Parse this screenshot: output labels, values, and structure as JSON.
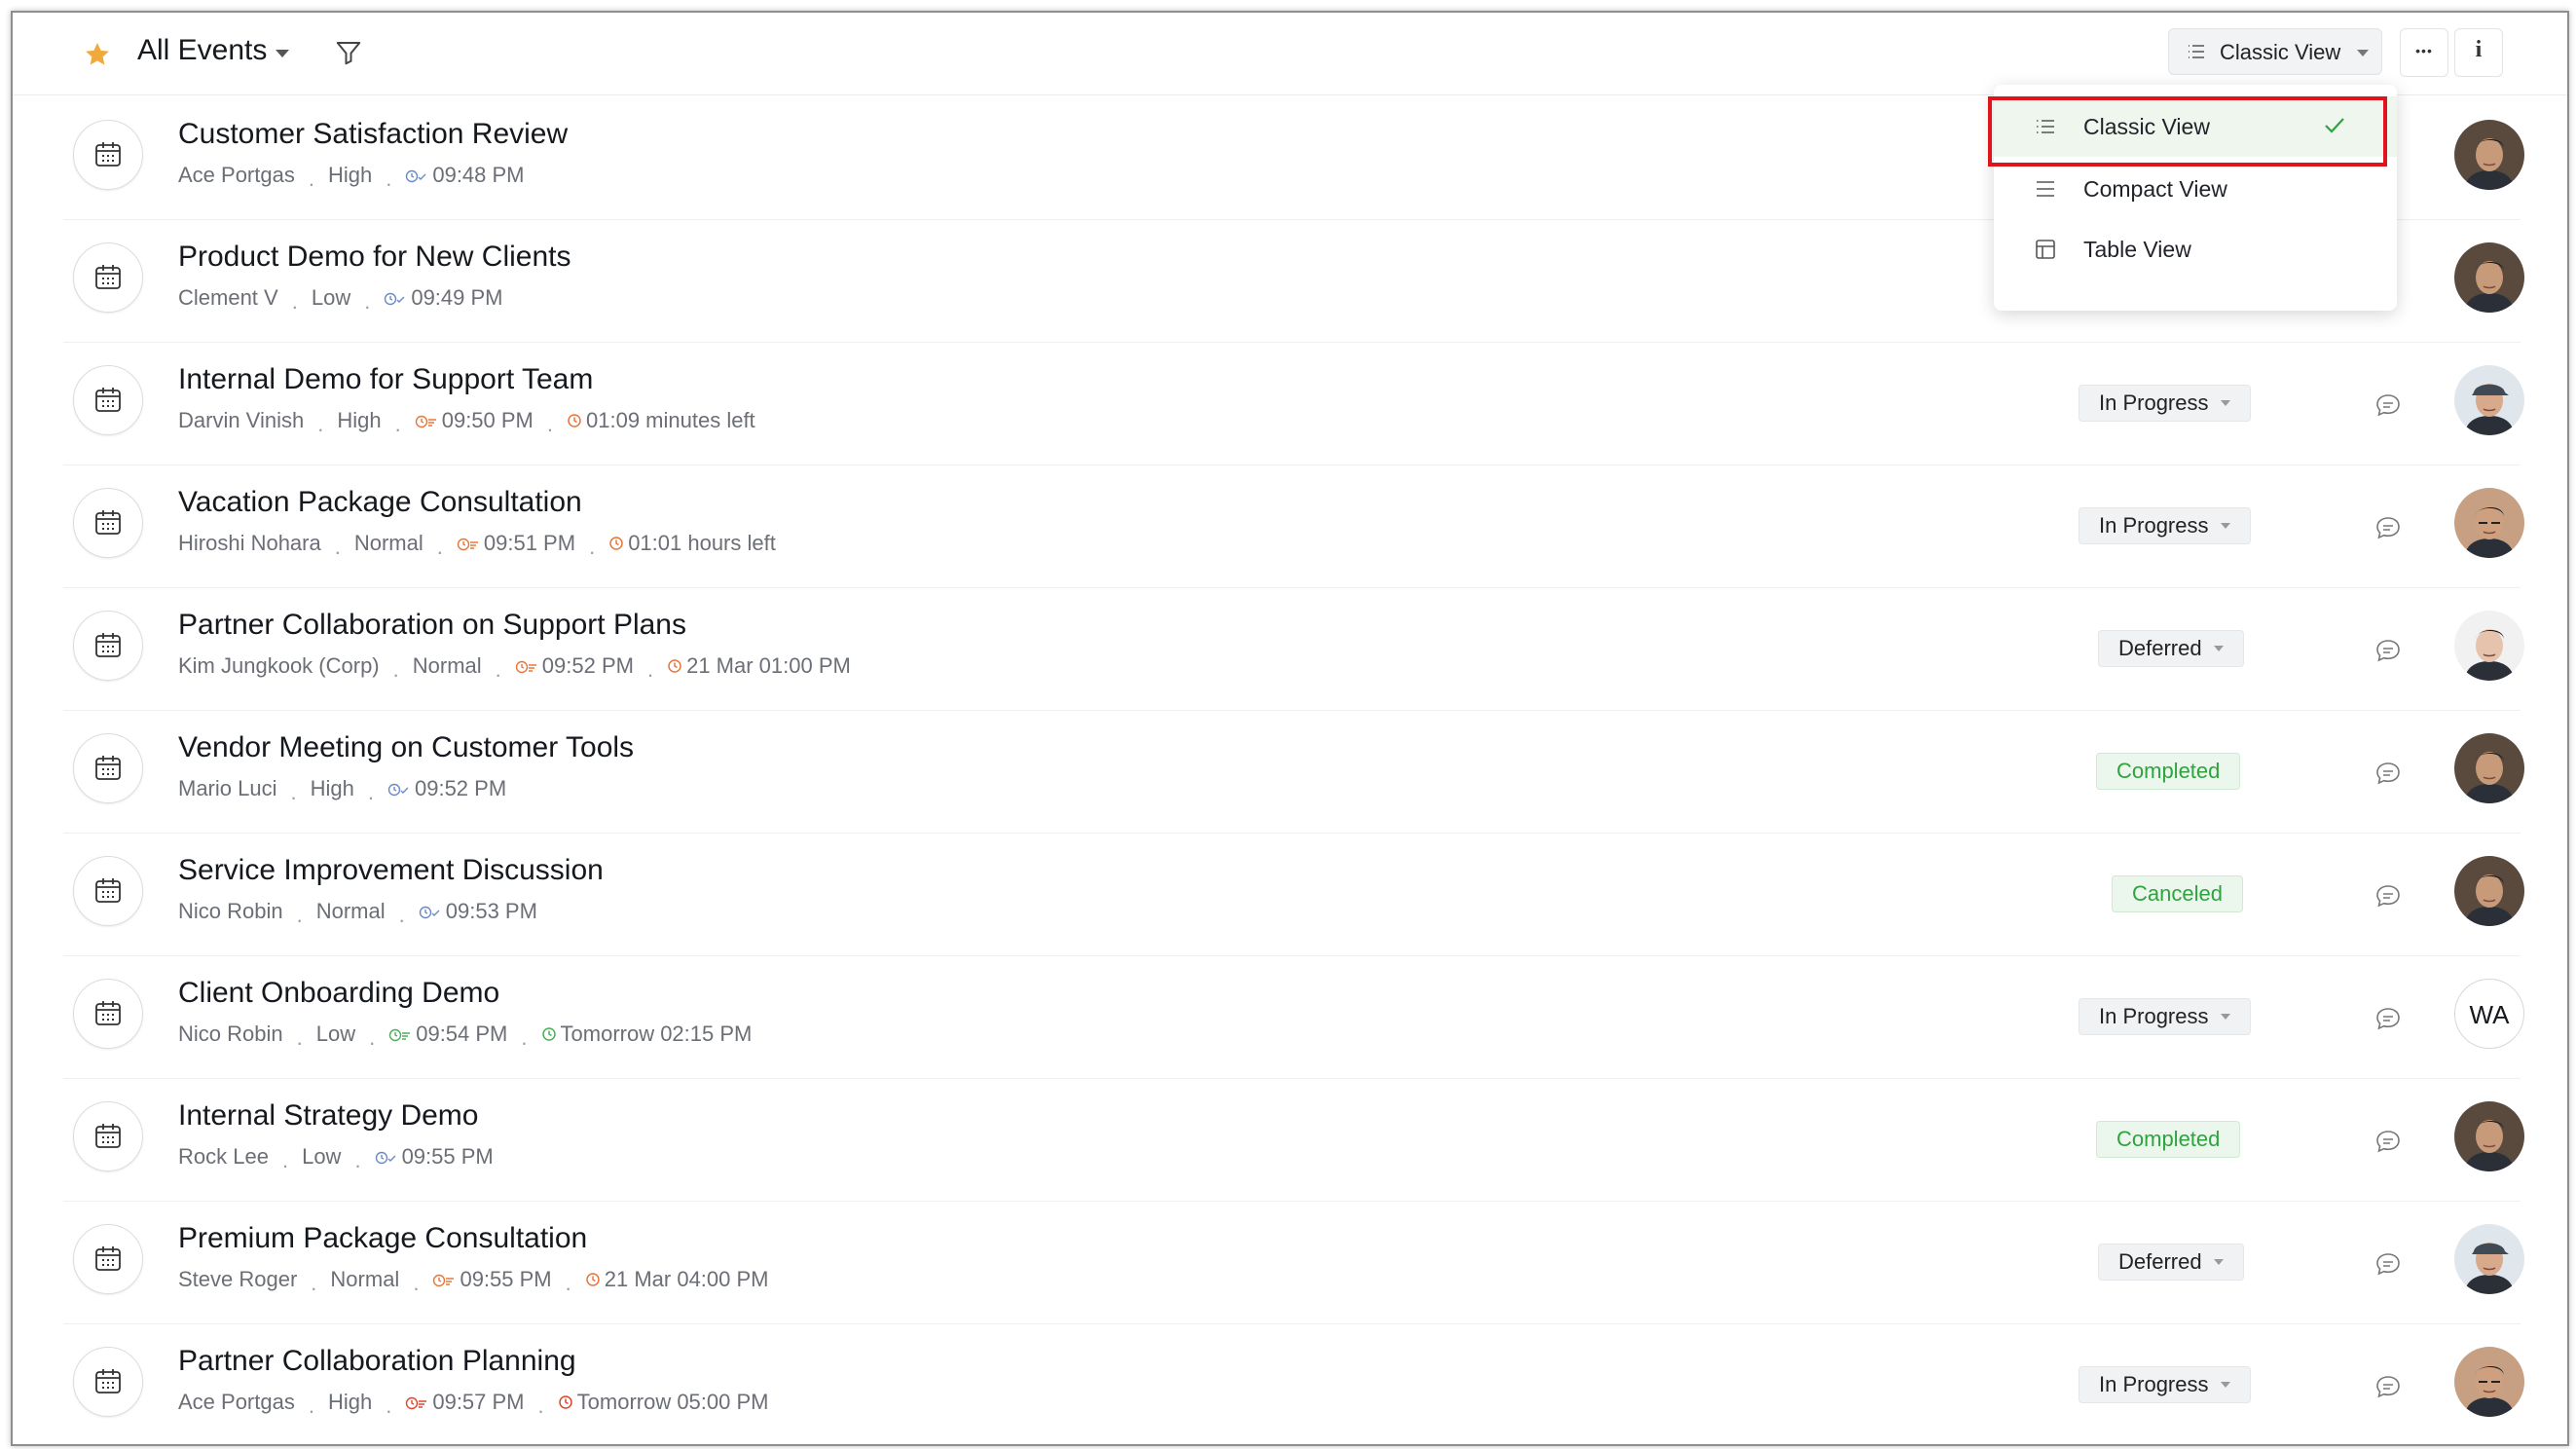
{
  "header": {
    "title": "All Events",
    "view_label": "Classic View",
    "more_label": "•••",
    "info_label": "i"
  },
  "dropdown": {
    "items": [
      {
        "label": "Classic View",
        "icon": "list-icon",
        "selected": true
      },
      {
        "label": "Compact View",
        "icon": "compact-list-icon",
        "selected": false
      },
      {
        "label": "Table View",
        "icon": "table-icon",
        "selected": false
      }
    ]
  },
  "colors": {
    "accent_green": "#2fa33f",
    "highlight_red": "#e0141c",
    "star": "#f0a93a",
    "overdue_orange": "#e8763a",
    "ontime_blue": "#6a8ac7",
    "due_green": "#4cae5a"
  },
  "events": [
    {
      "title": "Customer Satisfaction Review",
      "owner": "Ace Portgas",
      "priority": "High",
      "time": "09:48 PM",
      "time_icon": "scheduled-icon",
      "due": "",
      "due_color": "",
      "status": "",
      "avatar": "man-dark-hair"
    },
    {
      "title": "Product Demo for New Clients",
      "owner": "Clement V",
      "priority": "Low",
      "time": "09:49 PM",
      "time_icon": "scheduled-icon",
      "due": "",
      "due_color": "",
      "status": "",
      "avatar": "man-dark-hair"
    },
    {
      "title": "Internal Demo for Support Team",
      "owner": "Darvin Vinish",
      "priority": "High",
      "time": "09:50 PM",
      "time_icon": "overdue-icon",
      "due": "01:09 minutes left",
      "due_color": "#e8763a",
      "status": "In Progress",
      "status_type": "prog",
      "avatar": "man-cap"
    },
    {
      "title": "Vacation Package Consultation",
      "owner": "Hiroshi Nohara",
      "priority": "Normal",
      "time": "09:51 PM",
      "time_icon": "overdue-icon",
      "due": "01:01 hours left",
      "due_color": "#e8763a",
      "status": "In Progress",
      "status_type": "prog",
      "avatar": "man-glasses"
    },
    {
      "title": "Partner Collaboration on Support Plans",
      "owner": "Kim Jungkook (Corp)",
      "priority": "Normal",
      "time": "09:52 PM",
      "time_icon": "overdue-icon",
      "due": "21 Mar 01:00 PM",
      "due_color": "#e8763a",
      "status": "Deferred",
      "status_type": "def",
      "avatar": "man-young"
    },
    {
      "title": "Vendor Meeting on Customer Tools",
      "owner": "Mario Luci",
      "priority": "High",
      "time": "09:52 PM",
      "time_icon": "scheduled-icon",
      "due": "",
      "due_color": "",
      "status": "Completed",
      "status_type": "comp",
      "avatar": "man-dark-hair"
    },
    {
      "title": "Service Improvement Discussion",
      "owner": "Nico Robin",
      "priority": "Normal",
      "time": "09:53 PM",
      "time_icon": "scheduled-icon",
      "due": "",
      "due_color": "",
      "status": "Canceled",
      "status_type": "canc",
      "avatar": "man-dark-hair"
    },
    {
      "title": "Client Onboarding Demo",
      "owner": "Nico Robin",
      "priority": "Low",
      "time": "09:54 PM",
      "time_icon": "due-icon",
      "due": "Tomorrow 02:15 PM",
      "due_color": "#4cae5a",
      "status": "In Progress",
      "status_type": "prog",
      "avatar": "WA"
    },
    {
      "title": "Internal Strategy Demo",
      "owner": "Rock Lee",
      "priority": "Low",
      "time": "09:55 PM",
      "time_icon": "scheduled-icon",
      "due": "",
      "due_color": "",
      "status": "Completed",
      "status_type": "comp",
      "avatar": "man-dark-hair"
    },
    {
      "title": "Premium Package Consultation",
      "owner": "Steve Roger",
      "priority": "Normal",
      "time": "09:55 PM",
      "time_icon": "overdue-icon",
      "due": "21 Mar 04:00 PM",
      "due_color": "#e8763a",
      "status": "Deferred",
      "status_type": "def",
      "avatar": "man-cap"
    },
    {
      "title": "Partner Collaboration Planning",
      "owner": "Ace Portgas",
      "priority": "High",
      "time": "09:57 PM",
      "time_icon": "overdue-red-icon",
      "due": "Tomorrow 05:00 PM",
      "due_color": "#e0452c",
      "status": "In Progress",
      "status_type": "prog",
      "avatar": "man-glasses"
    }
  ]
}
